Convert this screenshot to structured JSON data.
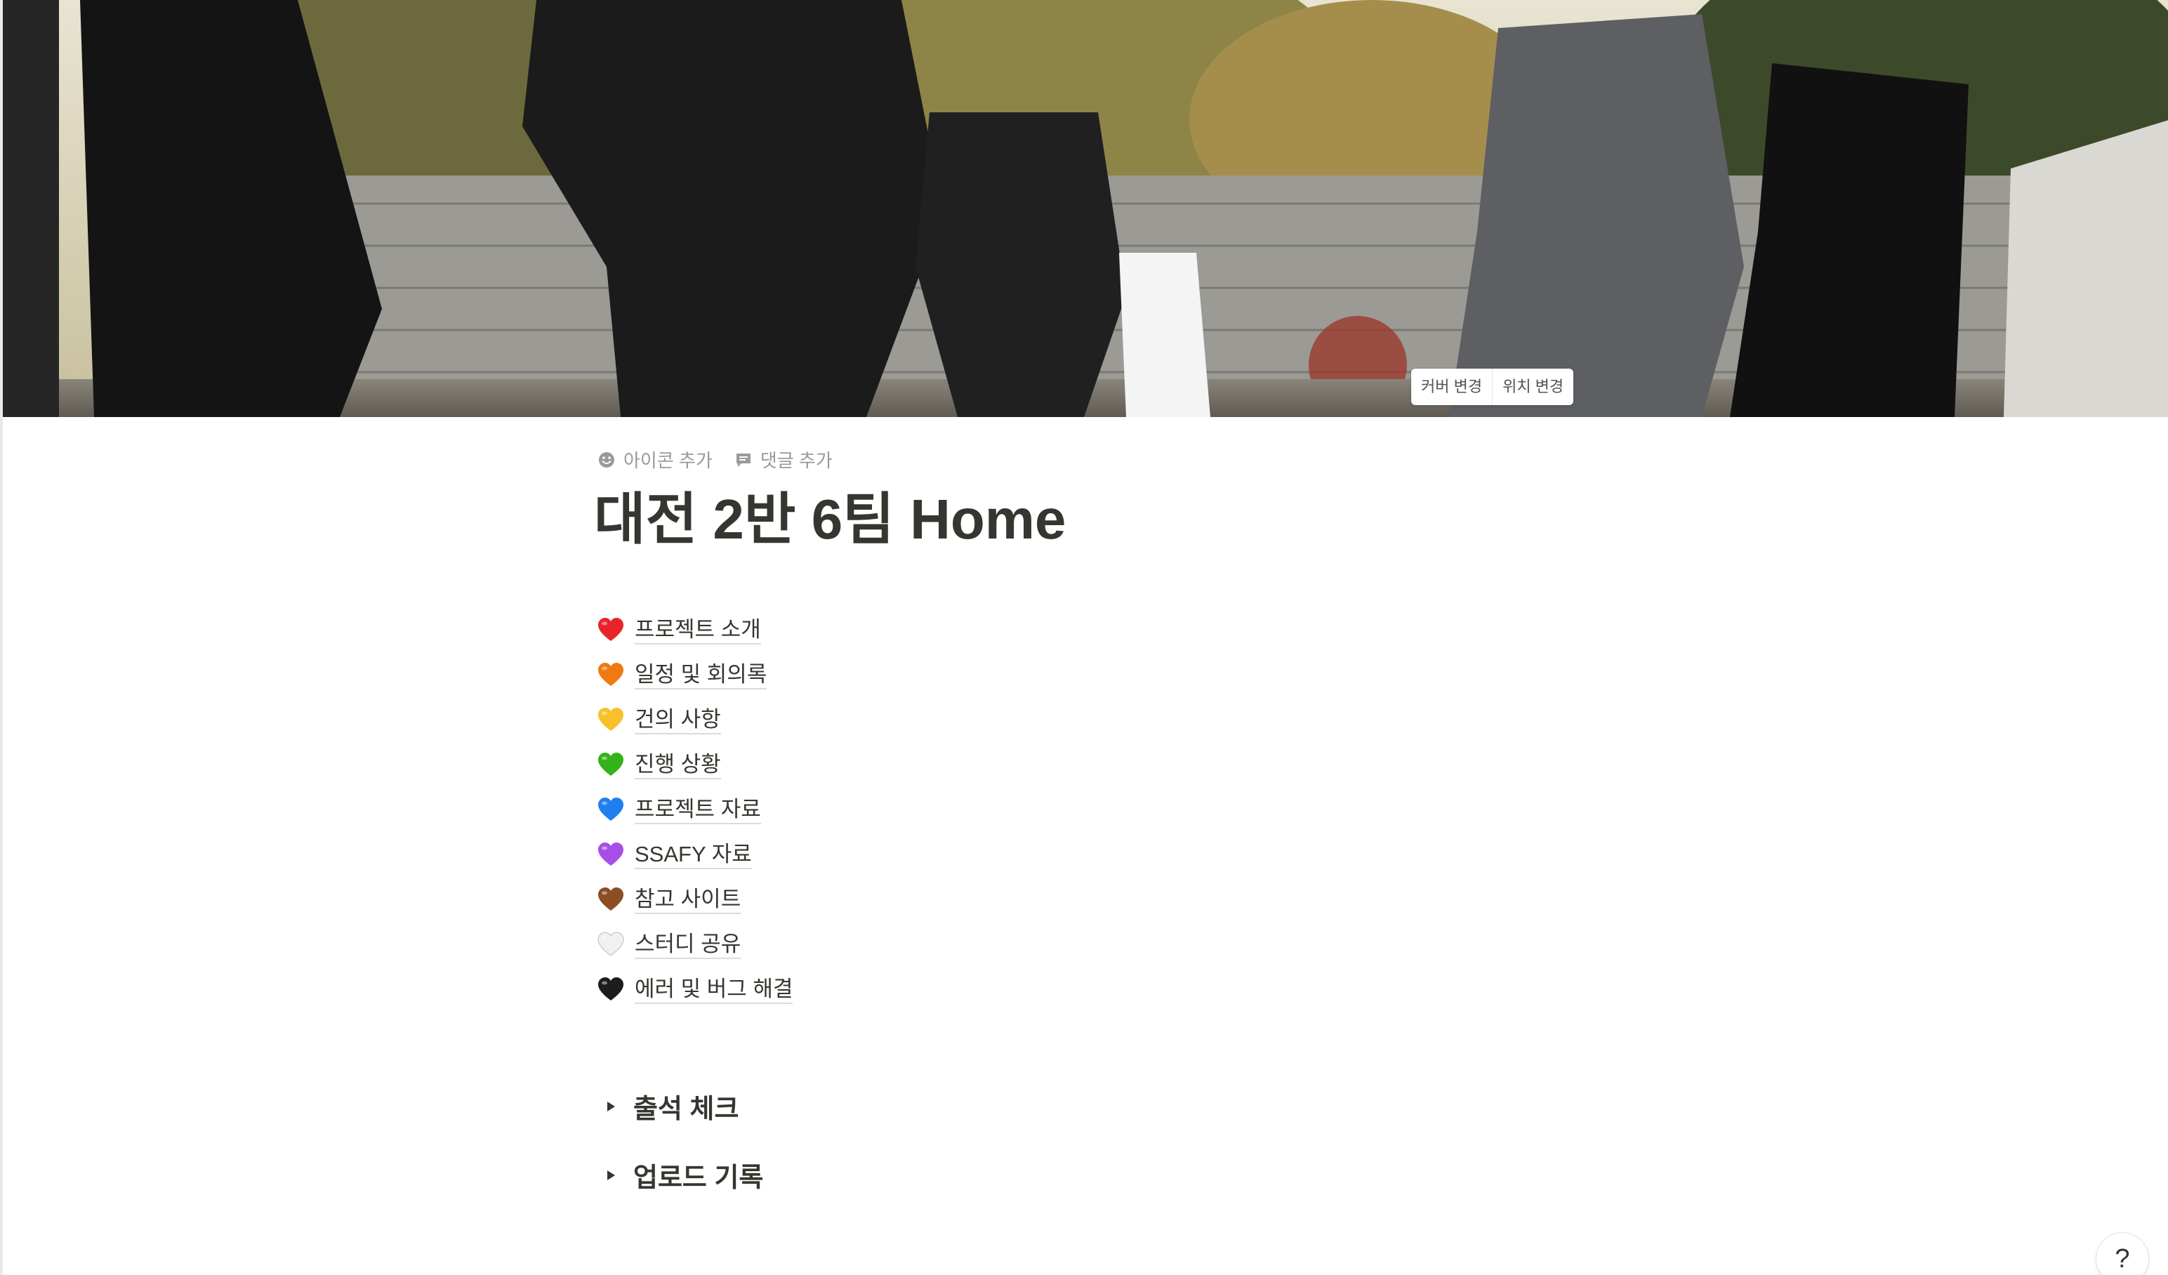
{
  "cover": {
    "change_cover_label": "커버 변경",
    "reposition_label": "위치 변경"
  },
  "page_controls": {
    "add_icon_label": "아이콘 추가",
    "add_comment_label": "댓글 추가"
  },
  "page": {
    "title": "대전 2반 6팀 Home"
  },
  "links": [
    {
      "icon": "red-heart-icon",
      "color": "#e8242b",
      "label": "프로젝트 소개"
    },
    {
      "icon": "orange-heart-icon",
      "color": "#f07a12",
      "label": "일정 및 회의록"
    },
    {
      "icon": "yellow-heart-icon",
      "color": "#f7c12c",
      "label": "건의 사항"
    },
    {
      "icon": "green-heart-icon",
      "color": "#34b21a",
      "label": "진행 상황"
    },
    {
      "icon": "blue-heart-icon",
      "color": "#1f7ff0",
      "label": "프로젝트 자료"
    },
    {
      "icon": "purple-heart-icon",
      "color": "#a94de8",
      "label": "SSAFY 자료"
    },
    {
      "icon": "brown-heart-icon",
      "color": "#8a4e22",
      "label": "참고 사이트"
    },
    {
      "icon": "white-heart-icon",
      "color": "#f1f1f1",
      "label": "스터디 공유"
    },
    {
      "icon": "black-heart-icon",
      "color": "#1d1d1d",
      "label": "에러 및 버그 해결"
    }
  ],
  "toggles": [
    {
      "label": "출석 체크"
    },
    {
      "label": "업로드 기록"
    }
  ],
  "help": {
    "label": "?"
  }
}
